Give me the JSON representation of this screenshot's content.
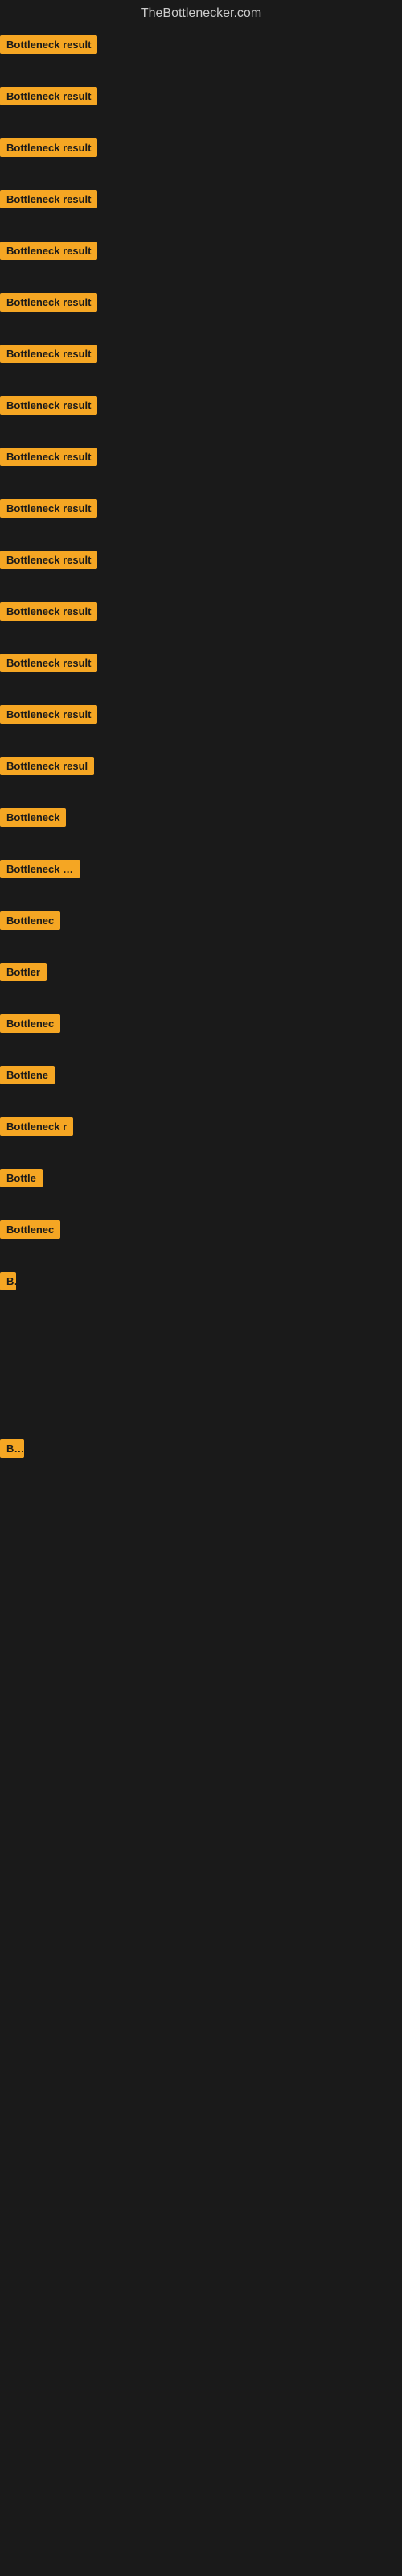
{
  "site": {
    "title": "TheBottlenecker.com"
  },
  "items": [
    {
      "id": 1,
      "label": "Bottleneck result",
      "badge_width": 130
    },
    {
      "id": 2,
      "label": "Bottleneck result",
      "badge_width": 130
    },
    {
      "id": 3,
      "label": "Bottleneck result",
      "badge_width": 130
    },
    {
      "id": 4,
      "label": "Bottleneck result",
      "badge_width": 130
    },
    {
      "id": 5,
      "label": "Bottleneck result",
      "badge_width": 130
    },
    {
      "id": 6,
      "label": "Bottleneck result",
      "badge_width": 130
    },
    {
      "id": 7,
      "label": "Bottleneck result",
      "badge_width": 130
    },
    {
      "id": 8,
      "label": "Bottleneck result",
      "badge_width": 130
    },
    {
      "id": 9,
      "label": "Bottleneck result",
      "badge_width": 130
    },
    {
      "id": 10,
      "label": "Bottleneck result",
      "badge_width": 130
    },
    {
      "id": 11,
      "label": "Bottleneck result",
      "badge_width": 130
    },
    {
      "id": 12,
      "label": "Bottleneck result",
      "badge_width": 130
    },
    {
      "id": 13,
      "label": "Bottleneck result",
      "badge_width": 130
    },
    {
      "id": 14,
      "label": "Bottleneck result",
      "badge_width": 130
    },
    {
      "id": 15,
      "label": "Bottleneck resul",
      "badge_width": 120
    },
    {
      "id": 16,
      "label": "Bottleneck",
      "badge_width": 90
    },
    {
      "id": 17,
      "label": "Bottleneck res",
      "badge_width": 100
    },
    {
      "id": 18,
      "label": "Bottlenec",
      "badge_width": 80
    },
    {
      "id": 19,
      "label": "Bottler",
      "badge_width": 60
    },
    {
      "id": 20,
      "label": "Bottlenec",
      "badge_width": 80
    },
    {
      "id": 21,
      "label": "Bottlene",
      "badge_width": 70
    },
    {
      "id": 22,
      "label": "Bottleneck r",
      "badge_width": 95
    },
    {
      "id": 23,
      "label": "Bottle",
      "badge_width": 55
    },
    {
      "id": 24,
      "label": "Bottlenec",
      "badge_width": 80
    },
    {
      "id": 25,
      "label": "B",
      "badge_width": 20
    },
    {
      "id": 26,
      "label": "",
      "badge_width": 5
    },
    {
      "id": 27,
      "label": "",
      "badge_width": 0
    },
    {
      "id": 28,
      "label": "",
      "badge_width": 0
    },
    {
      "id": 29,
      "label": "",
      "badge_width": 0
    },
    {
      "id": 30,
      "label": "Bo",
      "badge_width": 30
    },
    {
      "id": 31,
      "label": "",
      "badge_width": 0
    },
    {
      "id": 32,
      "label": "",
      "badge_width": 0
    },
    {
      "id": 33,
      "label": "",
      "badge_width": 0
    },
    {
      "id": 34,
      "label": "",
      "badge_width": 0
    }
  ]
}
